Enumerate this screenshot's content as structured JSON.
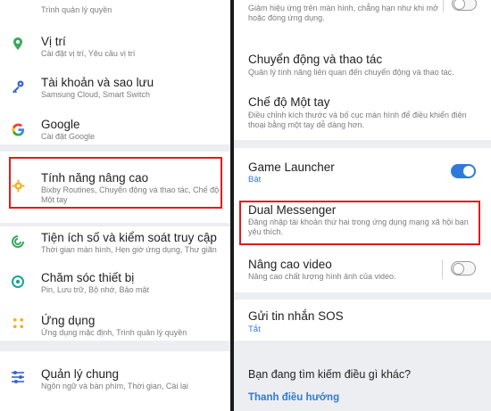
{
  "left": {
    "items": [
      {
        "title": "",
        "subtitle": "Trình quản lý quyền",
        "icon": "permission-icon"
      },
      {
        "title": "Vị trí",
        "subtitle": "Cài đặt vị trí, Yêu cầu vị trí",
        "icon": "location-pin-icon"
      },
      {
        "title": "Tài khoản và sao lưu",
        "subtitle": "Samsung Cloud, Smart Switch",
        "icon": "key-icon"
      },
      {
        "title": "Google",
        "subtitle": "Cài đặt Google",
        "icon": "google-icon"
      },
      {
        "title": "Tính năng nâng cao",
        "subtitle": "Bixby Routines, Chuyển động và thao tác, Chế độ Một tay",
        "icon": "advanced-features-icon"
      },
      {
        "title": "Tiện ích số và kiểm soát truy cập",
        "subtitle": "Thời gian màn hình, Hẹn giờ ứng dụng, Thư giãn",
        "icon": "digital-wellbeing-icon"
      },
      {
        "title": "Chăm sóc thiết bị",
        "subtitle": "Pin, Lưu trữ, Bộ nhớ, Bảo mật",
        "icon": "device-care-icon"
      },
      {
        "title": "Ứng dụng",
        "subtitle": "Ứng dụng mặc định, Trình quản lý quyền",
        "icon": "apps-icon"
      },
      {
        "title": "Quản lý chung",
        "subtitle": "Ngôn ngữ và bàn phím, Thời gian, Cài lại",
        "icon": "general-management-icon"
      }
    ]
  },
  "right": {
    "top_text": "Giảm hiệu ứng trên màn hình, chẳng hạn như khi mở hoặc đóng ứng dụng.",
    "motions": {
      "title": "Chuyển động và thao tác",
      "subtitle": "Quản lý tính năng liên quan đến chuyển động và thao tác."
    },
    "one_hand": {
      "title": "Chế độ Một tay",
      "subtitle": "Điều chỉnh kích thước và bố cục màn hình để điều khiển điện thoại bằng một tay dễ dàng hơn."
    },
    "game_launcher": {
      "title": "Game Launcher",
      "status": "Bật",
      "enabled": true
    },
    "dual_messenger": {
      "title": "Dual Messenger",
      "subtitle": "Đăng nhập tài khoản thứ hai trong ứng dụng mạng xã hội bạn yêu thích."
    },
    "video": {
      "title": "Nâng cao video",
      "subtitle": "Nâng cao chất lượng hình ảnh của video.",
      "enabled": false
    },
    "sos": {
      "title": "Gửi tin nhắn SOS",
      "status": "Tắt"
    },
    "search_prompt": "Bạn đang tìm kiếm điều gì khác?",
    "nav_link": "Thanh điều hướng"
  },
  "colors": {
    "accent": "#2f7ad8",
    "highlight": "#e01b1b",
    "background": "#eceef1"
  }
}
